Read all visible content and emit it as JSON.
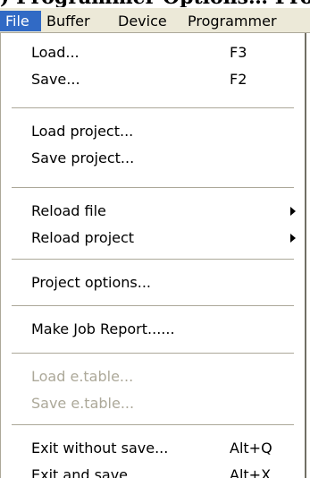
{
  "document": {
    "cropped_heading": ") Programmer Options… Project…"
  },
  "menubar": {
    "items": [
      {
        "label": "File",
        "selected": true
      },
      {
        "label": "Buffer"
      },
      {
        "label": "Device"
      },
      {
        "label": "Programmer"
      }
    ]
  },
  "file_menu": {
    "items": [
      {
        "label": "Load...",
        "shortcut": "F3"
      },
      {
        "label": "Save...",
        "shortcut": "F2"
      },
      {
        "label": "Load project..."
      },
      {
        "label": "Save project..."
      },
      {
        "label": "Reload file",
        "submenu": true
      },
      {
        "label": "Reload project",
        "submenu": true
      },
      {
        "label": "Project options..."
      },
      {
        "label": "Make Job Report......"
      },
      {
        "label": "Load e.table...",
        "disabled": true
      },
      {
        "label": "Save e.table...",
        "disabled": true
      },
      {
        "label": "Exit without save...",
        "shortcut": "Alt+Q"
      },
      {
        "label": "Exit and save...",
        "shortcut": "Alt+X"
      }
    ]
  },
  "colors": {
    "menubar_bg": "#ece9d8",
    "selection": "#316ac5",
    "disabled_text": "#aca899"
  }
}
